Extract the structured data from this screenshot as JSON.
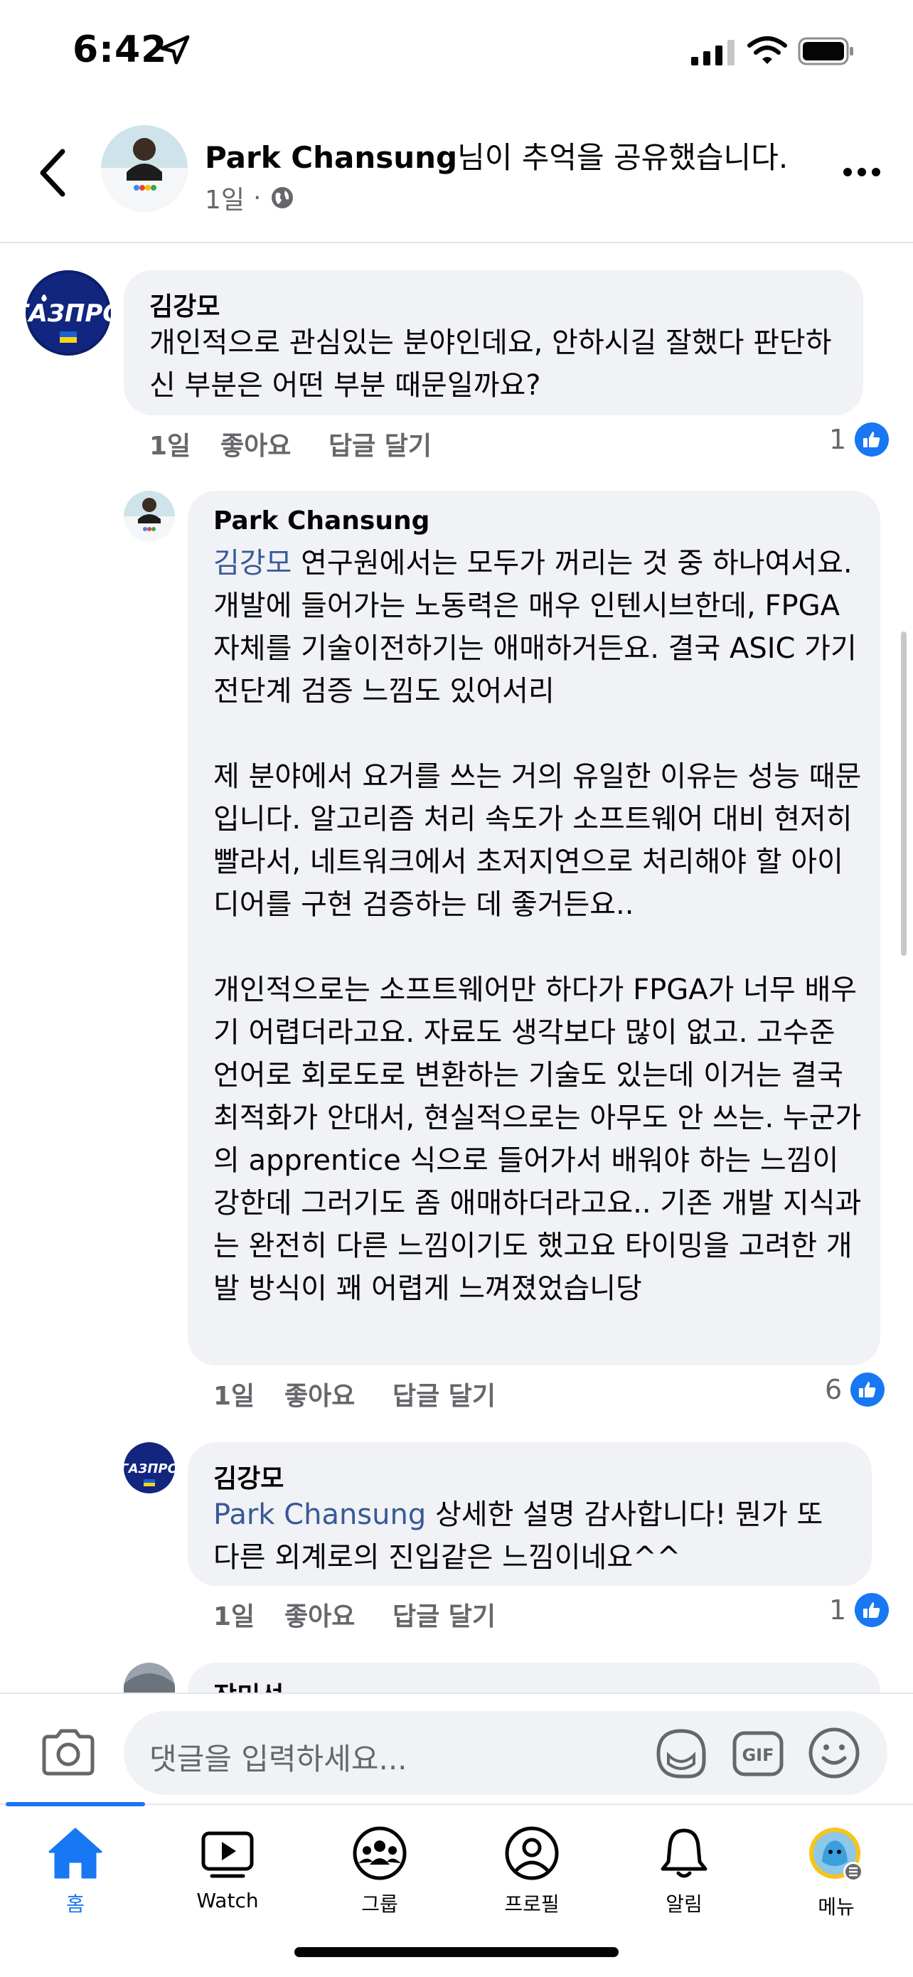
{
  "status_bar": {
    "time": "6:42"
  },
  "header": {
    "author": "Park Chansung",
    "title_suffix": "님이 추억을 공유했습니다.",
    "age": "1일",
    "separator": "·"
  },
  "comments": [
    {
      "author": "김강모",
      "mention": "",
      "text": "개인적으로 관심있는 분야인데요, 안하시길 잘했다 판단하신 부분은 어떤 부분 때문일까요?",
      "age": "1일",
      "like_label": "좋아요",
      "reply_label": "답글 달기",
      "like_count": "1"
    },
    {
      "author": "Park Chansung",
      "mention": "김강모",
      "text": " 연구원에서는 모두가 꺼리는 것 중 하나여서요. 개발에 들어가는 노동력은 매우 인텐시브한데, FPGA 자체를 기술이전하기는  애매하거든요.  결국 ASIC 가기 전단계 검증 느낌도 있어서리\n\n제 분야에서 요거를 쓰는 거의 유일한 이유는 성능 때문입니다. 알고리즘 처리 속도가 소프트웨어 대비 현저히 빨라서, 네트워크에서 초저지연으로 처리해야 할 아이디어를 구현 검증하는 데 좋거든요..\n\n개인적으로는 소프트웨어만 하다가 FPGA가 너무 배우기 어렵더라고요. 자료도 생각보다 많이 없고. 고수준 언어로 회로도로 변환하는 기술도 있는데 이거는 결국 최적화가 안대서, 현실적으로는 아무도 안 쓰는. 누군가의 apprentice 식으로 들어가서 배워야 하는 느낌이 강한데 그러기도 좀 애매하더라고요.. 기존 개발 지식과는 완전히 다른 느낌이기도 했고요 타이밍을 고려한 개발 방식이 꽤 어렵게 느껴졌었습니당",
      "age": "1일",
      "like_label": "좋아요",
      "reply_label": "답글 달기",
      "like_count": "6"
    },
    {
      "author": "김강모",
      "mention": "Park Chansung",
      "text": " 상세한 설명 감사합니다! 뭔가 또 다른 외계로의 진입같은 느낌이네요^^",
      "age": "1일",
      "like_label": "좋아요",
      "reply_label": "답글 달기",
      "like_count": "1"
    },
    {
      "author": "장미선"
    }
  ],
  "composer": {
    "placeholder": "댓글을 입력하세요..."
  },
  "tabs": [
    {
      "label": "홈",
      "icon": "home-icon"
    },
    {
      "label": "Watch",
      "icon": "watch-icon"
    },
    {
      "label": "그룹",
      "icon": "groups-icon"
    },
    {
      "label": "프로필",
      "icon": "profile-icon"
    },
    {
      "label": "알림",
      "icon": "bell-icon"
    },
    {
      "label": "메뉴",
      "icon": "menu-avatar-icon"
    }
  ],
  "colors": {
    "accent": "#1877f2",
    "bubble": "#f0f2f5",
    "mention": "#385898",
    "secondary_text": "#65676b"
  }
}
